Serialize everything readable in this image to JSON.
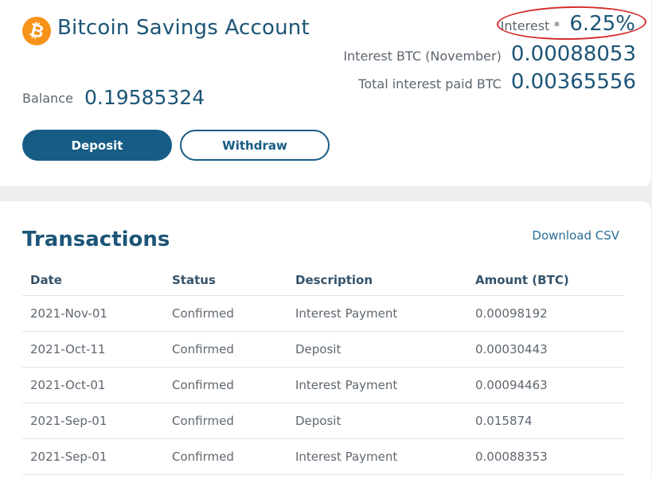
{
  "account": {
    "title": "Bitcoin Savings Account",
    "logo_symbol": "₿",
    "balance_label": "Balance",
    "balance_value": "0.19585324"
  },
  "stats": {
    "interest_label": "Interest *",
    "interest_value": "6.25%",
    "month_label": "Interest BTC (November)",
    "month_value": "0.00088053",
    "total_label": "Total interest paid BTC",
    "total_value": "0.00365556"
  },
  "actions": {
    "deposit_label": "Deposit",
    "withdraw_label": "Withdraw"
  },
  "transactions": {
    "title": "Transactions",
    "download_label": "Download CSV",
    "headers": [
      "Date",
      "Status",
      "Description",
      "Amount (BTC)"
    ],
    "rows": [
      [
        "2021-Nov-01",
        "Confirmed",
        "Interest Payment",
        "0.00098192"
      ],
      [
        "2021-Oct-11",
        "Confirmed",
        "Deposit",
        "0.00030443"
      ],
      [
        "2021-Oct-01",
        "Confirmed",
        "Interest Payment",
        "0.00094463"
      ],
      [
        "2021-Sep-01",
        "Confirmed",
        "Deposit",
        "0.015874"
      ],
      [
        "2021-Sep-01",
        "Confirmed",
        "Interest Payment",
        "0.00088353"
      ]
    ]
  },
  "colors": {
    "brand": "#175c85",
    "bitcoin": "#f7931a",
    "highlight": "#d42a2a"
  },
  "icons": {
    "logo": "bitcoin-icon"
  }
}
